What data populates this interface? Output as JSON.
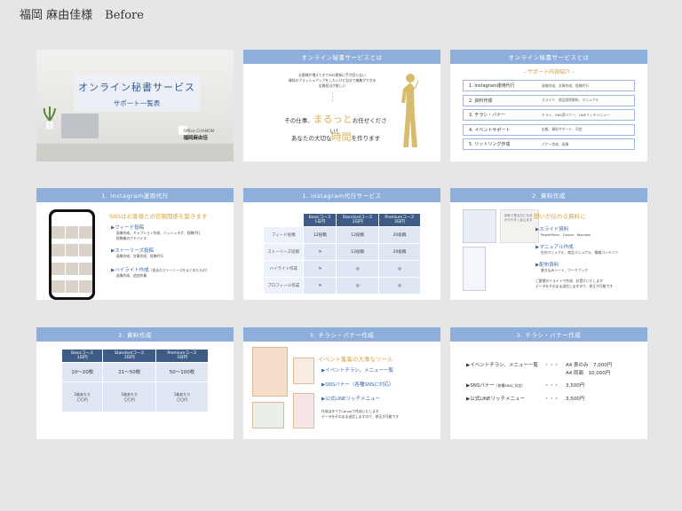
{
  "page": {
    "title_name": "福岡 麻由佳様",
    "title_label": "Before"
  },
  "slide1": {
    "title": "オンライン秘書サービス",
    "subtitle": "サポート一覧表",
    "office": "Office CHANON",
    "name": "福岡麻由佳"
  },
  "slide2": {
    "bar": "オンライン秘書サービスとは",
    "small": [
      "お客様が増えてきてSNS更新に手が回らない",
      "資料のブラッシュアップをしたいけど自分で編集ができる",
      "広報担当が欲しい"
    ],
    "dots": "・\n・\n・",
    "line1_pre": "その仕事、",
    "line1_big": "まるっと",
    "line1_post": "お任せください！",
    "line2_pre": "あなたの大切な",
    "line2_big": "時間",
    "line2_post": "を作ります"
  },
  "slide3": {
    "bar": "オンライン秘書サービスとは",
    "subtitle": "– サポート内容紹介 –",
    "rows": [
      {
        "label": "1. Instagram運用代行",
        "desc": "画像作成、文章作成、投稿代行"
      },
      {
        "label": "2. 資料作成",
        "desc": "スライド、商品説明資料、マニュアル"
      },
      {
        "label": "3. チラシ・バナー",
        "desc": "チラシ、SNS用バナー、LINEリッチメニュー"
      },
      {
        "label": "4. イベントサポート",
        "desc": "広報、資料サポート、司会"
      },
      {
        "label": "5. リットリング作成",
        "desc": "パナー作成、画像"
      }
    ]
  },
  "slide4": {
    "bar": "1. Instagram運用代行",
    "head": "SNSはお客様との信頼関係を築きます",
    "items": [
      {
        "title": "▶フィード投稿",
        "desc": [
          "画像作成、キャプション作成、ハッシュタグ、投稿代行",
          "投稿後のアドバイス"
        ]
      },
      {
        "title": "▶ストーリーズ投稿",
        "desc": [
          "画像作成、文章作成、投稿代行"
        ]
      },
      {
        "title": "▶ハイライト作成",
        "note": "（過去のストーリーズをまとめたもの）",
        "desc": [
          "画像作成、追加作業"
        ]
      }
    ]
  },
  "slide5": {
    "bar": "1. Instagram代行サービス",
    "headers": [
      "",
      "Basicコース\n1日円",
      "Standardコース\n2日円",
      "Premiumコース\n3日円"
    ],
    "rows": [
      [
        "フィード投稿",
        "12投稿",
        "12投稿",
        "20投稿"
      ],
      [
        "ストーリーズ投稿",
        "✕",
        "12投稿",
        "20投稿"
      ],
      [
        "ハイライト作成",
        "✕",
        "◎",
        "◎"
      ],
      [
        "プロフィール作成",
        "✕",
        "◎",
        "◎"
      ]
    ]
  },
  "slide6": {
    "bar": "2. 資料作成",
    "head": "想いが伝わる資料に",
    "thumb_text": "初めて見る方にも分かりやすく伝えます",
    "items": [
      {
        "title": "▶スライド資料",
        "desc": "PowerPoint、Canva、Keynote"
      },
      {
        "title": "▶マニュアル作成",
        "desc": "社内マニュアル、商品マニュアル、情報コンテンツ"
      },
      {
        "title": "▶配布資料",
        "desc": "書き込みシート、ワークブック"
      }
    ],
    "foot": [
      "ご要望のリライトで作成、お受けいたします",
      "データをそのまま送信しますので、修正が可能です"
    ]
  },
  "slide7": {
    "bar": "2. 資料作成",
    "headers": [
      "Basicコース\n1日円",
      "Standardコース\n2日円",
      "Premiumコース\n3日円"
    ],
    "ranges": [
      "10～20枚",
      "21～50枚",
      "50～100枚"
    ],
    "notes": [
      "1枚あたり\n〇〇円",
      "1枚あたり\n〇〇円",
      "1枚あたり\n〇〇円"
    ]
  },
  "slide8": {
    "bar": "3. チラシ・バナー作成",
    "head": "イベント集客の大事なツール",
    "items": [
      "▶イベントチラシ、メニュー一覧",
      "▶SNSバナー（各種SNSに対応）",
      "▶公式LINEリッチメニュー"
    ],
    "foot": [
      "作成はすべてCanvaで作成いたします",
      "データをそのまま送信しますので、修正が可能です"
    ]
  },
  "slide9": {
    "bar": "3. チラシ・バナー作成",
    "lines": [
      {
        "label": "▶イベントチラシ、メニュー一覧",
        "dots": "・・・",
        "price1": "A4 表のみ　7,000円",
        "price2": "A4 両面　10,000円"
      },
      {
        "label": "▶SNSバナー",
        "small": "（各種SNSに対応）",
        "dots": "・・・",
        "price1": "3,500円"
      },
      {
        "label": "▶公式LINEリッチメニュー",
        "dots": "・・・",
        "price1": "3,500円"
      }
    ]
  }
}
